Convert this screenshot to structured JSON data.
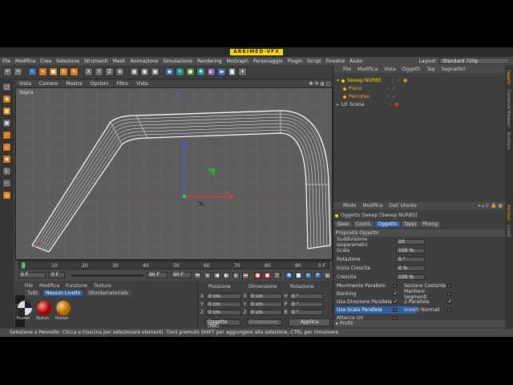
{
  "window": {
    "title": "ARKIMED-VFX"
  },
  "menubar": [
    "File",
    "Modifica",
    "Crea",
    "Selezione",
    "Strumenti",
    "Mesh",
    "Animazione",
    "Simulazione",
    "Rendering",
    "MoGraph",
    "Personaggio",
    "Plugin",
    "Script",
    "Finestre",
    "Aiuto"
  ],
  "layout": {
    "label": "Layout:",
    "value": "Standard 720p"
  },
  "viewport": {
    "menu": [
      "Vista",
      "Camere",
      "Mostra",
      "Opzioni",
      "Filtro",
      "Vista"
    ],
    "view_name": "Sopra",
    "axis_z": "Z",
    "axis_x": "X"
  },
  "toolbar": {
    "undo": "↶",
    "xyz": [
      "X",
      "Y",
      "Z"
    ]
  },
  "timeline": {
    "ticks": [
      "0",
      "10",
      "20",
      "30",
      "40",
      "50",
      "60",
      "70",
      "80",
      "90"
    ],
    "start_frame": "0 F",
    "current_frame": "0 F",
    "end_frame": "90 F",
    "end_frame2": "90 F",
    "frame_readout": "0 F"
  },
  "materials": {
    "menu": [
      "File",
      "Modifica",
      "Funzione",
      "Texture"
    ],
    "filters": [
      "Tutti",
      "Nessun Livello",
      "Sfondamateriale"
    ],
    "items": [
      "Nuovo",
      "Nuovo",
      "Nuovo"
    ],
    "colors": {
      "black": "#222222",
      "red": "#cc2222",
      "orange": "#d98a1c"
    }
  },
  "coords": {
    "headers": [
      "Posizione",
      "Dimensione",
      "Rotazione"
    ],
    "rows": [
      {
        "axis": "X",
        "pos": "0 cm",
        "size_axis": "X",
        "size": "0 cm",
        "rot_axis": "H",
        "rot": "0 °"
      },
      {
        "axis": "Y",
        "pos": "0 cm",
        "size_axis": "Y",
        "size": "0 cm",
        "rot_axis": "P",
        "rot": "0 °"
      },
      {
        "axis": "Z",
        "pos": "0 cm",
        "size_axis": "Z",
        "size": "0 cm",
        "rot_axis": "B",
        "rot": "0 °"
      }
    ],
    "mode": "Oggetto (Rel)",
    "dim_mode": "Dimensione",
    "apply": "Applica"
  },
  "objects": {
    "menu": [
      "File",
      "Modifica",
      "Vista",
      "Oggetti",
      "Tag",
      "Segnalibri"
    ],
    "items": [
      {
        "name": "Sweep NURBS",
        "color": "#ffd800"
      },
      {
        "name": "Piano",
        "color": "#ffaa22"
      },
      {
        "name": "Percorso",
        "color": "#ffaa22"
      },
      {
        "name": "Scena",
        "color": "#dddddd"
      }
    ],
    "side_tabs": [
      "Oggetti",
      "Contenuti Browser",
      "Struttura"
    ]
  },
  "attributes": {
    "menu": [
      "Modo",
      "Modifica",
      "Dati Utente"
    ],
    "object_title": "Oggetto Sweep [Sweep NURBS]",
    "tabs": [
      "Base",
      "Coord.",
      "Oggetto",
      "Tappi",
      "Phong"
    ],
    "active_tab": "Oggetto",
    "section": "Proprietà Oggetto",
    "fields": [
      {
        "label": "Suddivisione Isoparametri",
        "value": "10"
      },
      {
        "label": "Scala",
        "value": "100 %"
      },
      {
        "label": "Rotazione",
        "value": "0 °"
      },
      {
        "label": "Inizia Crescita",
        "value": "0 %"
      },
      {
        "label": "Crescita",
        "value": "100 %"
      }
    ],
    "checks_left": [
      {
        "label": "Movimento Parallelo",
        "checked": false
      },
      {
        "label": "Banking",
        "checked": true
      },
      {
        "label": "Usa Direzione Parallela",
        "checked": true
      },
      {
        "label": "Usa Scala Parallela",
        "checked": false
      },
      {
        "label": "Attacca UV",
        "checked": false
      }
    ],
    "checks_right": [
      {
        "label": "Sezione Costante",
        "checked": false
      },
      {
        "label": "Mantieni Segmenti",
        "checked": false
      },
      {
        "label": "2-Parallela",
        "checked": true
      },
      {
        "label": "Inverti Normali",
        "checked": false
      }
    ],
    "profile": "Profili",
    "side_tabs": [
      "Attributi",
      "Livelli"
    ]
  },
  "statusbar": {
    "text": "Selezione a Pennello: Clicca e trascina per selezionare elementi. Tieni premuto SHIFT per aggiungere alla selezione, CTRL per rimuovere."
  }
}
